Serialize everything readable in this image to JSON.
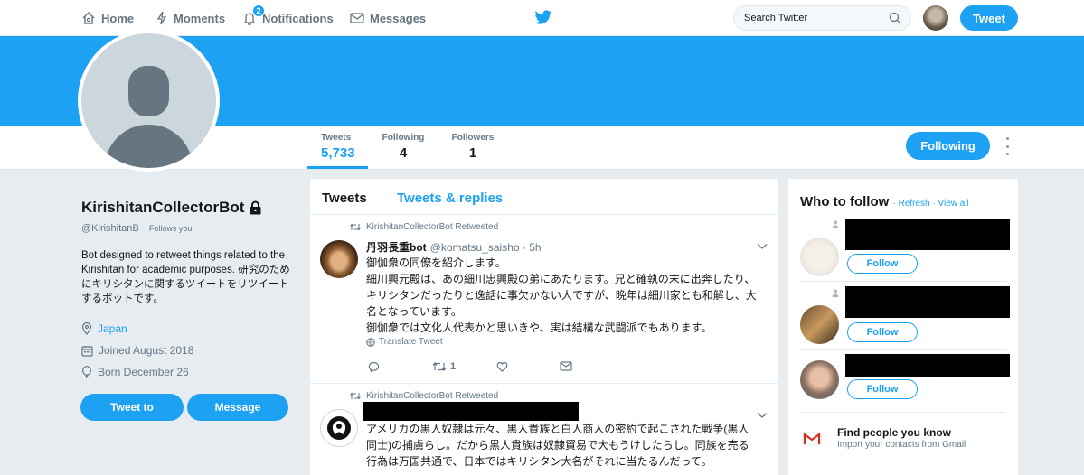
{
  "nav": {
    "home": "Home",
    "moments": "Moments",
    "notifications": "Notifications",
    "notifications_count": "2",
    "messages": "Messages",
    "search_placeholder": "Search Twitter",
    "tweet_button": "Tweet"
  },
  "profile": {
    "name": "KirishitanCollectorBot",
    "handle": "@KirishitanB",
    "follows_you": "Follows you",
    "bio": "Bot designed to retweet things related to the Kirishitan for academic purposes. 研究のためにキリシタンに関するツイートをリツイートするボットです。",
    "location": "Japan",
    "joined": "Joined August 2018",
    "born": "Born December 26",
    "tweet_to": "Tweet to",
    "message": "Message"
  },
  "stats": {
    "tweets_label": "Tweets",
    "tweets_value": "5,733",
    "following_label": "Following",
    "following_value": "4",
    "followers_label": "Followers",
    "followers_value": "1",
    "following_button": "Following"
  },
  "timeline": {
    "tab_tweets": "Tweets",
    "tab_replies": "Tweets & replies",
    "tweets": [
      {
        "retweeted_by": "KirishitanCollectorBot Retweeted",
        "name": "丹羽長重bot",
        "handle": "@komatsu_saisho · 5h",
        "text_lines": [
          "御伽衆の同僚を紹介します。",
          "細川興元殿は、あの細川忠興殿の弟にあたります。兄と確執の末に出奔したり、",
          "キリシタンだったりと逸話に事欠かない人ですが、晩年は細川家とも和解し、大",
          "名となっています。",
          "御伽衆では文化人代表かと思いきや、実は結構な武闘派でもあります。"
        ],
        "translate": "Translate Tweet",
        "retweet_count": "1"
      },
      {
        "retweeted_by": "KirishitanCollectorBot Retweeted",
        "text_lines": [
          "アメリカの黒人奴隷は元々、黒人貴族と白人商人の密約で起こされた戦争(黒人",
          "同士)の捕虜らし。だから黒人貴族は奴隷貿易で大もうけしたらし。同族を売る",
          "行為は万国共通で、日本ではキリシタン大名がそれに当たるんだって。"
        ]
      }
    ]
  },
  "who_to_follow": {
    "title": "Who to follow",
    "refresh": "Refresh",
    "view_all": "View all",
    "follow_label": "Follow",
    "find_people_title": "Find people you know",
    "find_people_sub": "Import your contacts from Gmail"
  },
  "colors": {
    "accent": "#1da1f2",
    "background": "#e6ecf0"
  }
}
